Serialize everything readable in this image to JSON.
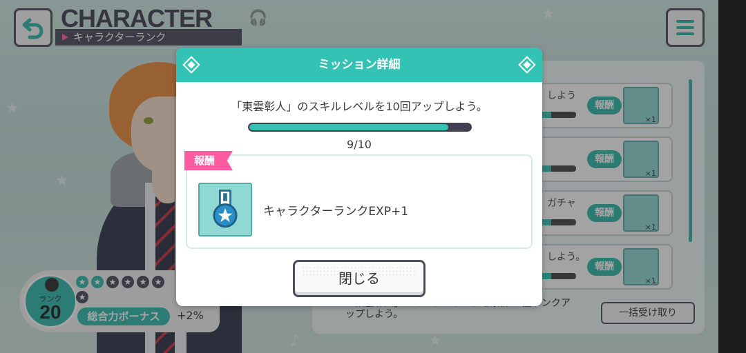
{
  "header": {
    "title": "CHARACTER",
    "subtitle": "キャラクターランク"
  },
  "mission_list": {
    "rows": [
      {
        "text": "しよう",
        "reward_label": "報酬",
        "qty": "×1"
      },
      {
        "text": "",
        "reward_label": "報酬",
        "qty": "×1"
      },
      {
        "text": "ガチャ",
        "reward_label": "報酬",
        "qty": "×1"
      },
      {
        "text": "しよう。",
        "reward_label": "報酬",
        "qty": "×1"
      }
    ],
    "footer_text_line1": "「東雲彰人」のマスターランクを累計10回ランクア",
    "footer_text_line2": "ップしよう。",
    "bulk_receive_label": "一括受け取り"
  },
  "rank_card": {
    "rank_label": "ランク",
    "rank_value": "20",
    "stars_filled": 2,
    "stars_total": 7,
    "bonus_label": "総合力ボーナス",
    "bonus_value": "+2%"
  },
  "modal": {
    "title": "ミッション詳細",
    "description": "「東雲彰人」のスキルレベルを10回アップしよう。",
    "progress_current": 9,
    "progress_max": 10,
    "progress_text": "9/10",
    "reward_tab": "報酬",
    "reward_item": "キャラクターランクEXP+1",
    "close_label": "閉じる"
  },
  "colors": {
    "accent": "#33c2b3",
    "reward_pink": "#ff5ba0",
    "dark": "#3f4152"
  }
}
